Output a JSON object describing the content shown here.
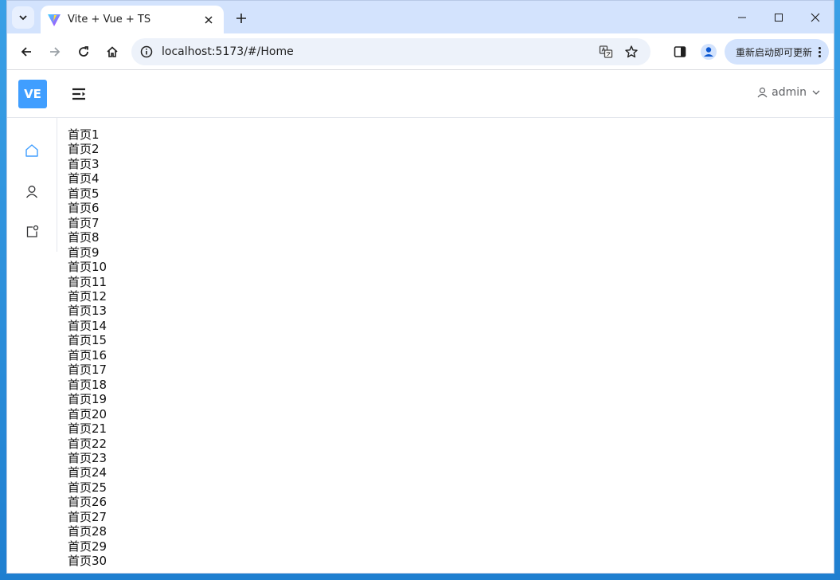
{
  "browser": {
    "tab_title": "Vite + Vue + TS",
    "url": "localhost:5173/#/Home",
    "update_label": "重新启动即可更新"
  },
  "app": {
    "logo": "VE",
    "user_name": "admin",
    "menu_icons": [
      "home-icon",
      "user-icon",
      "app-icon"
    ]
  },
  "content": {
    "lines": [
      "首页1",
      "首页2",
      "首页3",
      "首页4",
      "首页5",
      "首页6",
      "首页7",
      "首页8",
      "首页9",
      "首页10",
      "首页11",
      "首页12",
      "首页13",
      "首页14",
      "首页15",
      "首页16",
      "首页17",
      "首页18",
      "首页19",
      "首页20",
      "首页21",
      "首页22",
      "首页23",
      "首页24",
      "首页25",
      "首页26",
      "首页27",
      "首页28",
      "首页29",
      "首页30"
    ]
  },
  "colors": {
    "accent": "#409eff",
    "tab_strip": "#d3e3fd",
    "omnibox": "#edf2fa"
  }
}
